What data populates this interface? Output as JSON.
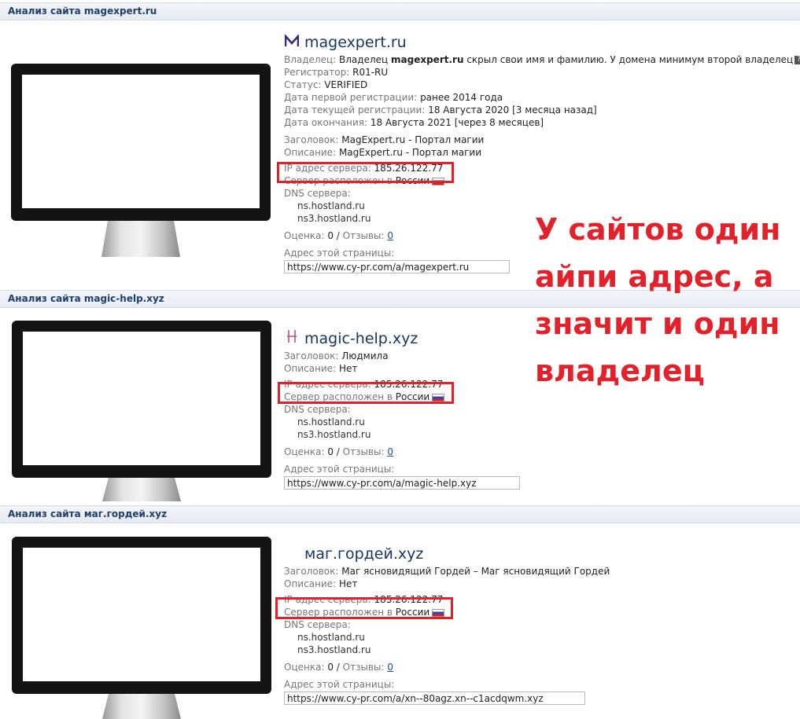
{
  "sites": [
    {
      "header": "Анализ сайта magexpert.ru",
      "domain": "magexpert.ru",
      "icon": "magexpert-logo-icon",
      "owner_label": "Владелец:",
      "owner_prefix": "Владелец ",
      "owner_name": "magexpert.ru",
      "owner_suffix": " скрыл свои имя и фамилию. У домена минимум второй владелец",
      "owner_help": "?",
      "registrar_label": "Регистратор:",
      "registrar": "R01-RU",
      "status_label": "Статус:",
      "status": "VERIFIED",
      "first_reg_label": "Дата первой регистрации:",
      "first_reg": "ранее 2014 года",
      "current_reg_label": "Дата текущей регистрации:",
      "current_reg": "18 Августа 2020 [3 месяца назад]",
      "expiry_label": "Дата окончания:",
      "expiry": "18 Августа 2021 [через 8 месяцев]",
      "title_label": "Заголовок:",
      "title": "MagExpert.ru - Портал магии",
      "description_label": "Описание:",
      "description": "MagExpert.ru - Портал магии",
      "ip_label": "IP адрес сервера:",
      "ip": "185.26.122.77",
      "location_label": "Сервер расположен в",
      "location": "России",
      "dns_label": "DNS сервера:",
      "dns": [
        "ns.hostland.ru",
        "ns3.hostland.ru"
      ],
      "rating_label": "Оценка:",
      "rating": "0",
      "reviews_label": "Отзывы:",
      "reviews": "0",
      "page_address_label": "Адрес этой страницы:",
      "page_url": "https://www.cy-pr.com/a/magexpert.ru"
    },
    {
      "header": "Анализ сайта magic-help.xyz",
      "domain": "magic-help.xyz",
      "icon": "magic-help-logo-icon",
      "title_label": "Заголовок:",
      "title": "Людмила",
      "description_label": "Описание:",
      "description": "Нет",
      "ip_label": "IP адрес сервера:",
      "ip": "185.26.122.77",
      "location_label": "Сервер расположен в",
      "location": "России",
      "dns_label": "DNS сервера:",
      "dns": [
        "ns.hostland.ru",
        "ns3.hostland.ru"
      ],
      "rating_label": "Оценка:",
      "rating": "0",
      "reviews_label": "Отзывы:",
      "reviews": "0",
      "page_address_label": "Адрес этой страницы:",
      "page_url": "https://www.cy-pr.com/a/magic-help.xyz"
    },
    {
      "header": "Анализ сайта маг.гордей.xyz",
      "domain": "маг.гордей.xyz",
      "title_label": "Заголовок:",
      "title": "Маг ясновидящий Гордей – Маг ясновидящий Гордей",
      "description_label": "Описание:",
      "description": "Нет",
      "ip_label": "IP адрес сервера:",
      "ip": "185.26.122.77",
      "location_label": "Сервер расположен в",
      "location": "России",
      "dns_label": "DNS сервера:",
      "dns": [
        "ns.hostland.ru",
        "ns3.hostland.ru"
      ],
      "rating_label": "Оценка:",
      "rating": "0",
      "reviews_label": "Отзывы:",
      "reviews": "0",
      "page_address_label": "Адрес этой страницы:",
      "page_url": "https://www.cy-pr.com/a/xn--80agz.xn--c1acdqwm.xyz"
    }
  ],
  "annotation": {
    "lines": [
      "У сайтов один",
      "айпи адрес, а",
      "значит и один",
      "владелец"
    ]
  },
  "colors": {
    "highlight": "#e2212b",
    "header_text": "#1c3f6e",
    "link": "#1a4f9c"
  }
}
